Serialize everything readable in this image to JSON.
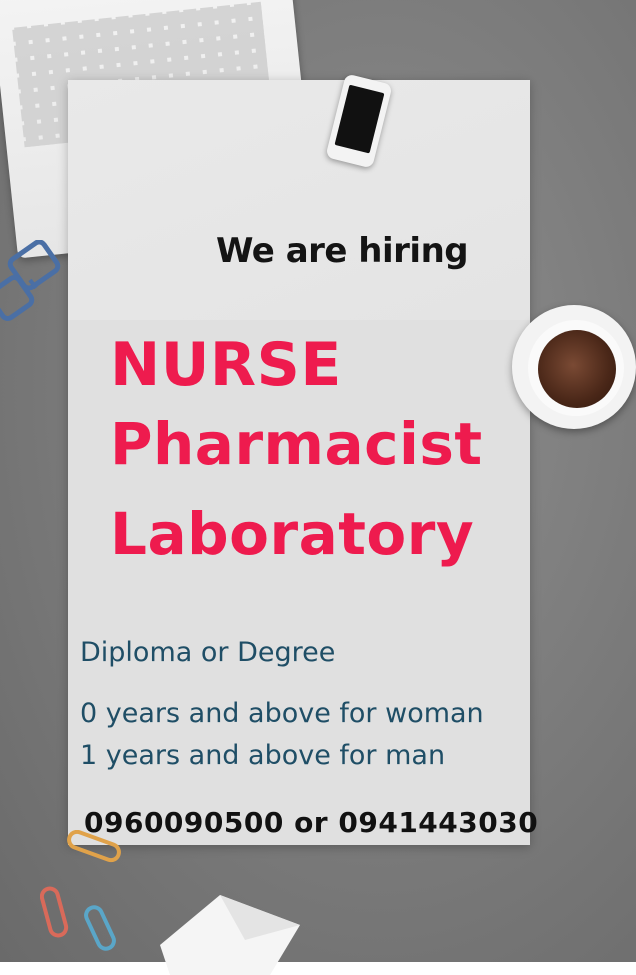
{
  "poster": {
    "headline": "We are hiring",
    "roles": [
      "NURSE",
      "Pharmacist",
      "Laboratory"
    ],
    "requirements": {
      "education": "Diploma or Degree",
      "experience_woman": "0 years and above for woman",
      "experience_man": "1 years and above for man"
    },
    "contact": "0960090500 or 0941443030"
  },
  "colors": {
    "role_text": "#ee1b4e",
    "requirement_text": "#1f4e66",
    "headline_text": "#141414",
    "desk": "#7a7a7a",
    "paper": "#e2e2e2"
  },
  "icons": [
    "laptop-icon",
    "phone-icon",
    "coffee-cup-icon",
    "glasses-icon",
    "paperclip-icon",
    "paper-shape-icon"
  ]
}
